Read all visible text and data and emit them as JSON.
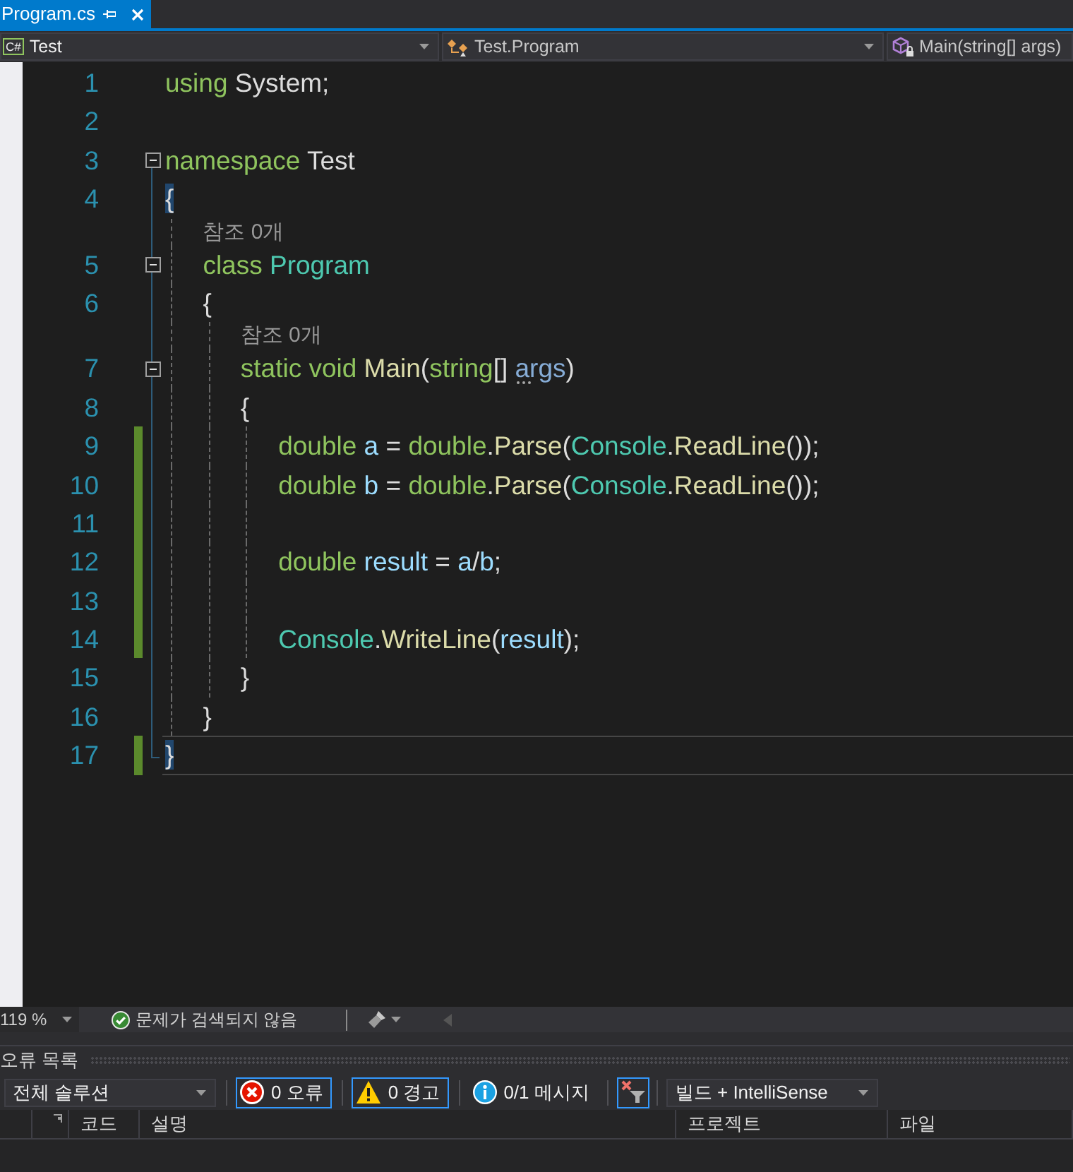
{
  "tabs": [
    {
      "label": "Program.cs",
      "selected": true
    }
  ],
  "nav_bar": {
    "project": {
      "badge": "C#",
      "label": "Test"
    },
    "type": "Test.Program",
    "member": "Main(string[] args)"
  },
  "editor": {
    "lines": [
      {
        "number": "1",
        "changed": false,
        "current": false,
        "code": [
          {
            "kind": "keyword",
            "text": "using"
          },
          {
            "kind": "plain",
            "text": " System;"
          }
        ]
      },
      {
        "number": "2",
        "changed": false,
        "current": false
      },
      {
        "number": "3",
        "changed": false,
        "current": false,
        "expanded": true,
        "code": [
          {
            "kind": "keyword",
            "text": "namespace"
          },
          {
            "kind": "plain",
            "text": " Test"
          }
        ]
      },
      {
        "number": "4",
        "changed": false,
        "current": false,
        "code": [
          {
            "kind": "brace",
            "text": "{",
            "matched": true
          }
        ]
      },
      {
        "number": "5",
        "changed": false,
        "current": false,
        "expanded": true,
        "codelens": "참조 0개",
        "code": [
          {
            "kind": "keyword",
            "text": "    class"
          },
          {
            "kind": "type",
            "text": " Program"
          }
        ]
      },
      {
        "number": "6",
        "changed": false,
        "current": false,
        "code": [
          {
            "kind": "brace",
            "text": "    {",
            "matched": false
          }
        ]
      },
      {
        "number": "7",
        "changed": false,
        "current": false,
        "expanded": true,
        "codelens": "참조 0개",
        "code": [
          {
            "kind": "keyword",
            "text": "        static void "
          },
          {
            "kind": "method",
            "text": "Main"
          },
          {
            "kind": "plain",
            "text": "("
          },
          {
            "kind": "keyword",
            "text": "string"
          },
          {
            "kind": "plain",
            "text": "[] "
          },
          {
            "kind": "parameter",
            "text": "args",
            "suggestion": true
          },
          {
            "kind": "plain",
            "text": ")"
          }
        ]
      },
      {
        "number": "8",
        "changed": false,
        "current": false,
        "code": [
          {
            "kind": "brace",
            "text": "        {",
            "matched": false
          }
        ]
      },
      {
        "number": "9",
        "changed": true,
        "current": false,
        "code": [
          {
            "kind": "keyword",
            "text": "            double"
          },
          {
            "kind": "variable",
            "text": " a"
          },
          {
            "kind": "plain",
            "text": " = "
          },
          {
            "kind": "keyword",
            "text": "double"
          },
          {
            "kind": "plain",
            "text": "."
          },
          {
            "kind": "method",
            "text": "Parse"
          },
          {
            "kind": "plain",
            "text": "("
          },
          {
            "kind": "type",
            "text": "Console"
          },
          {
            "kind": "plain",
            "text": "."
          },
          {
            "kind": "method",
            "text": "ReadLine"
          },
          {
            "kind": "plain",
            "text": "());"
          }
        ]
      },
      {
        "number": "10",
        "changed": true,
        "current": false,
        "code": [
          {
            "kind": "keyword",
            "text": "            double"
          },
          {
            "kind": "variable",
            "text": " b"
          },
          {
            "kind": "plain",
            "text": " = "
          },
          {
            "kind": "keyword",
            "text": "double"
          },
          {
            "kind": "plain",
            "text": "."
          },
          {
            "kind": "method",
            "text": "Parse"
          },
          {
            "kind": "plain",
            "text": "("
          },
          {
            "kind": "type",
            "text": "Console"
          },
          {
            "kind": "plain",
            "text": "."
          },
          {
            "kind": "method",
            "text": "ReadLine"
          },
          {
            "kind": "plain",
            "text": "());"
          }
        ]
      },
      {
        "number": "11",
        "changed": true,
        "current": false
      },
      {
        "number": "12",
        "changed": true,
        "current": false,
        "code": [
          {
            "kind": "keyword",
            "text": "            double"
          },
          {
            "kind": "variable",
            "text": " result"
          },
          {
            "kind": "plain",
            "text": " = "
          },
          {
            "kind": "variable",
            "text": "a"
          },
          {
            "kind": "plain",
            "text": "/"
          },
          {
            "kind": "variable",
            "text": "b"
          },
          {
            "kind": "plain",
            "text": ";"
          }
        ]
      },
      {
        "number": "13",
        "changed": true,
        "current": false
      },
      {
        "number": "14",
        "changed": true,
        "current": false,
        "code": [
          {
            "kind": "type",
            "text": "            Console"
          },
          {
            "kind": "plain",
            "text": "."
          },
          {
            "kind": "method",
            "text": "WriteLine"
          },
          {
            "kind": "plain",
            "text": "("
          },
          {
            "kind": "variable",
            "text": "result"
          },
          {
            "kind": "plain",
            "text": ");"
          }
        ]
      },
      {
        "number": "15",
        "changed": false,
        "current": false,
        "code": [
          {
            "kind": "brace",
            "text": "        }",
            "matched": false
          }
        ]
      },
      {
        "number": "16",
        "changed": false,
        "current": false,
        "code": [
          {
            "kind": "brace",
            "text": "    }",
            "matched": false
          }
        ]
      },
      {
        "number": "17",
        "changed": true,
        "current": true,
        "code": [
          {
            "kind": "brace",
            "text": "}",
            "matched": true
          }
        ]
      }
    ]
  },
  "status_bar": {
    "zoom": "119 %",
    "issues": "문제가 검색되지 않음"
  },
  "error_list": {
    "title": "오류 목록",
    "scope": "전체 솔루션",
    "filters": [
      {
        "kind": "error",
        "label": "0 오류",
        "selected": true
      },
      {
        "kind": "warning",
        "label": "0 경고",
        "selected": true
      },
      {
        "kind": "info",
        "label": "0/1 메시지",
        "selected": false
      }
    ],
    "filter_toggle": {
      "on": true
    },
    "source": "빌드 + IntelliSense",
    "columns": [
      "코드",
      "설명",
      "프로젝트",
      "파일"
    ]
  }
}
